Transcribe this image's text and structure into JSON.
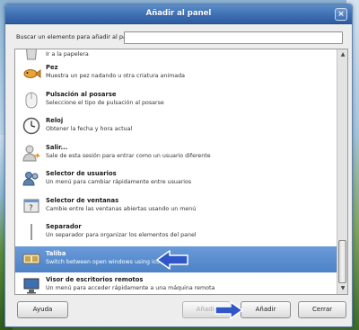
{
  "window": {
    "title": "Añadir al panel"
  },
  "search": {
    "label": "Buscar un elemento para añadir al panel:",
    "value": ""
  },
  "items": [
    {
      "name": "",
      "desc": "Ir a la papelera",
      "icon": "trash-icon"
    },
    {
      "name": "Pez",
      "desc": "Muestra un pez nadando u otra criatura animada",
      "icon": "fish-icon"
    },
    {
      "name": "Pulsación al posarse",
      "desc": "Seleccione el tipo de pulsación al posarse",
      "icon": "mouse-icon"
    },
    {
      "name": "Reloj",
      "desc": "Obtener la fecha y hora actual",
      "icon": "clock-icon"
    },
    {
      "name": "Salir...",
      "desc": "Sale de esta sesión para entrar como un usuario diferente",
      "icon": "logout-icon"
    },
    {
      "name": "Selector de usuarios",
      "desc": "Un menú para cambiar rápidamente entre usuarios",
      "icon": "users-icon"
    },
    {
      "name": "Selector de ventanas",
      "desc": "Cambie entre las ventanas abiertas usando un menú",
      "icon": "window-selector-icon"
    },
    {
      "name": "Separador",
      "desc": "Un separador para organizar los elementos del panel",
      "icon": "separator-icon"
    },
    {
      "name": "Taliba",
      "desc": "Switch between open windows using icons",
      "icon": "taskbar-icon",
      "selected": true
    },
    {
      "name": "Visor de escritorios remotos",
      "desc": "Un menú para acceder rápidamente a una máquina remota",
      "icon": "remote-desktop-icon"
    }
  ],
  "buttons": {
    "help": "Ayuda",
    "add_disabled": "Añadir",
    "add": "Añadir",
    "close": "Cerrar"
  },
  "colors": {
    "selection": "#5a8fd0",
    "titlebar": "#3e6fb3",
    "annotation_arrow": "#2f57c8"
  }
}
